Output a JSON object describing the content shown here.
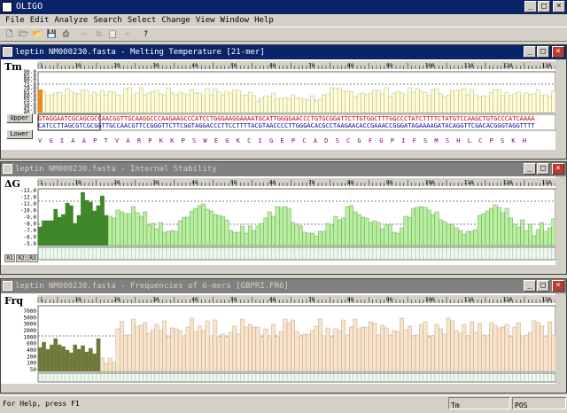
{
  "app": {
    "title": "OLIGO"
  },
  "menu": [
    "File",
    "Edit",
    "Analyze",
    "Search",
    "Select",
    "Change",
    "View",
    "Window",
    "Help"
  ],
  "toolbar": [
    "new",
    "open",
    "open2",
    "save",
    "print",
    "cut",
    "copy",
    "paste",
    "undo",
    "help"
  ],
  "windows": [
    {
      "id": "tm",
      "title": "leptin NM000230.fasta - Melting Temperature [21-mer]",
      "ylabel": "Tm",
      "y_ticks": [
        "90.0",
        "85.0",
        "80.0",
        "75.0",
        "70.0",
        "65.0",
        "60.0",
        "55.0",
        "50.0",
        "45.0",
        "40.0"
      ],
      "ruler": [
        "1",
        "10",
        "20",
        "30",
        "40",
        "50",
        "60",
        "70",
        "80",
        "90",
        "100",
        "110",
        "120",
        "130"
      ],
      "upper_label": "Upper",
      "lower_label": "Lower",
      "seq_top": "GTAGGAATCGCAGCGCCAACGGTTGCAAGGCCCAAGAAGCCCATCCTGGGAAGGAAAATGCATTGGGGAACCCTGTGCGGATTCTTGTGGCTTTGGCCCTATCTTTTCTATGTCCAAGCTGTGCCCATCAAAA",
      "seq_bot": "CATCCTTAGCGTCGCGGTTGCCAACGTTCCGGGTTCTTCGGTAGGACCCTTCCTTTTACGTAACCCCTTGGGACACGCCTAAGAACACCGAAACCGGGATAGAAAAGATACAGGTTCGACACGGGTAGGTTTT",
      "protein": "V G I A A P T V A R P K K P S W E G K C I G E P C A D S C G F G P I F S M S H L C P S K H"
    },
    {
      "id": "dg",
      "title": "leptin NM000230.fasta - Internal Stability",
      "ylabel": "ΔG",
      "y_ticks": [
        "-13.0",
        "-12.0",
        "-11.0",
        "-10.0",
        "-9.0",
        "-8.0",
        "-7.0",
        "-6.0",
        "-5.0"
      ],
      "ruler": [
        "1",
        "10",
        "20",
        "30",
        "40",
        "50",
        "60",
        "70",
        "80",
        "90",
        "100",
        "110",
        "120",
        "130"
      ],
      "buttons": [
        "R1",
        "R2",
        "R3"
      ]
    },
    {
      "id": "frq",
      "title": "leptin NM000230.fasta - Frequencies of 6-mers [GBPRI.FR6]",
      "ylabel": "Frq",
      "y_ticks": [
        "7000",
        "5000",
        "3000",
        "2000",
        "1000",
        "600",
        "400",
        "200",
        "100",
        "50"
      ],
      "ruler": [
        "1",
        "10",
        "20",
        "30",
        "40",
        "50",
        "60",
        "70",
        "80",
        "90",
        "100",
        "110",
        "120",
        "130"
      ]
    }
  ],
  "status": {
    "help": "For Help, press F1",
    "tm": "Tm",
    "pos": "POS"
  },
  "colors": {
    "tm_fill": "#fffcd8",
    "tm_stroke": "#8a8a40",
    "dg_fill": "#b8f0a0",
    "dg_dark": "#3e8a2a",
    "frq_fill": "#f9e4cc",
    "frq_dark": "#6b7a3a",
    "accent": "#0a246a"
  }
}
